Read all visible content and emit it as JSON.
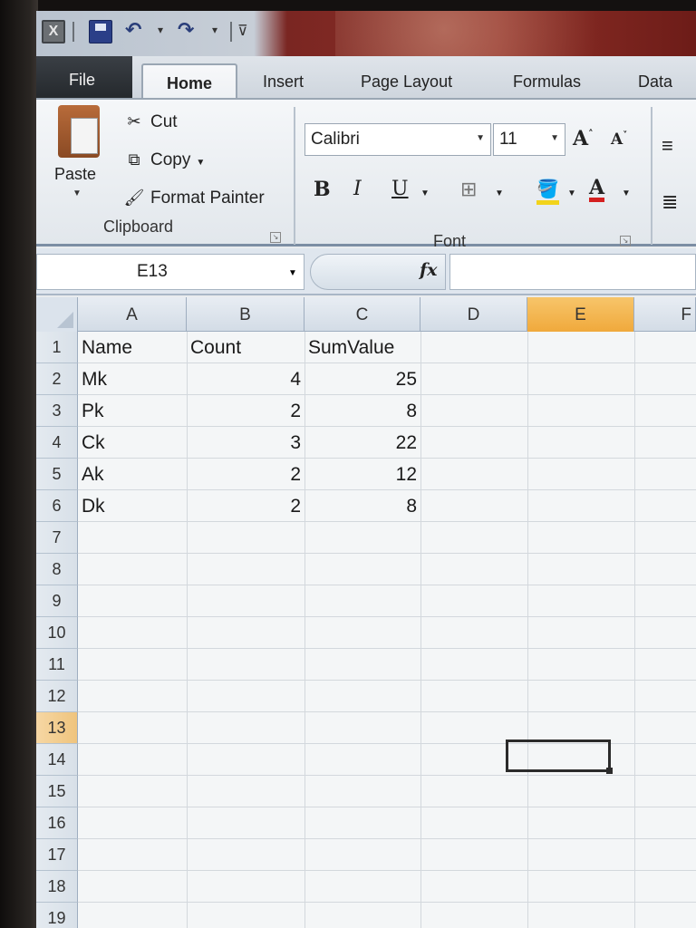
{
  "quick_access": {
    "excel_icon": "excel-icon",
    "save_icon": "save-icon",
    "undo_icon": "undo-icon",
    "redo_icon": "redo-icon",
    "customize_icon": "customize-qat-icon"
  },
  "tabs": [
    {
      "label": "File"
    },
    {
      "label": "Home"
    },
    {
      "label": "Insert"
    },
    {
      "label": "Page Layout"
    },
    {
      "label": "Formulas"
    },
    {
      "label": "Data"
    }
  ],
  "ribbon": {
    "clipboard": {
      "paste_label": "Paste",
      "cut_label": "Cut",
      "copy_label": "Copy",
      "format_painter_label": "Format Painter",
      "group_label": "Clipboard"
    },
    "font": {
      "font_name": "Calibri",
      "font_size": "11",
      "bold": "B",
      "italic": "I",
      "underline": "U",
      "grow": "A",
      "shrink": "A",
      "font_color": "A",
      "group_label": "Font"
    }
  },
  "formula_bar": {
    "name_box": "E13",
    "fx_label": "fx",
    "formula": ""
  },
  "columns": [
    "A",
    "B",
    "C",
    "D",
    "E",
    "F"
  ],
  "selected_column": "E",
  "rows": [
    "1",
    "2",
    "3",
    "4",
    "5",
    "6",
    "7",
    "8",
    "9",
    "10",
    "11",
    "12",
    "13",
    "14",
    "15",
    "16",
    "17",
    "18",
    "19"
  ],
  "selected_row": "13",
  "cells": {
    "A1": "Name",
    "B1": "Count",
    "C1": "SumValue",
    "A2": "Mk",
    "B2": "4",
    "C2": "25",
    "A3": "Pk",
    "B3": "2",
    "C3": "8",
    "A4": "Ck",
    "B4": "3",
    "C4": "22",
    "A5": "Ak",
    "B5": "2",
    "C5": "12",
    "A6": "Dk",
    "B6": "2",
    "C6": "8"
  },
  "colors": {
    "selected_header": "#f0a93c",
    "file_tab": "#2b3035",
    "title_bar_red": "#8e2f27"
  }
}
